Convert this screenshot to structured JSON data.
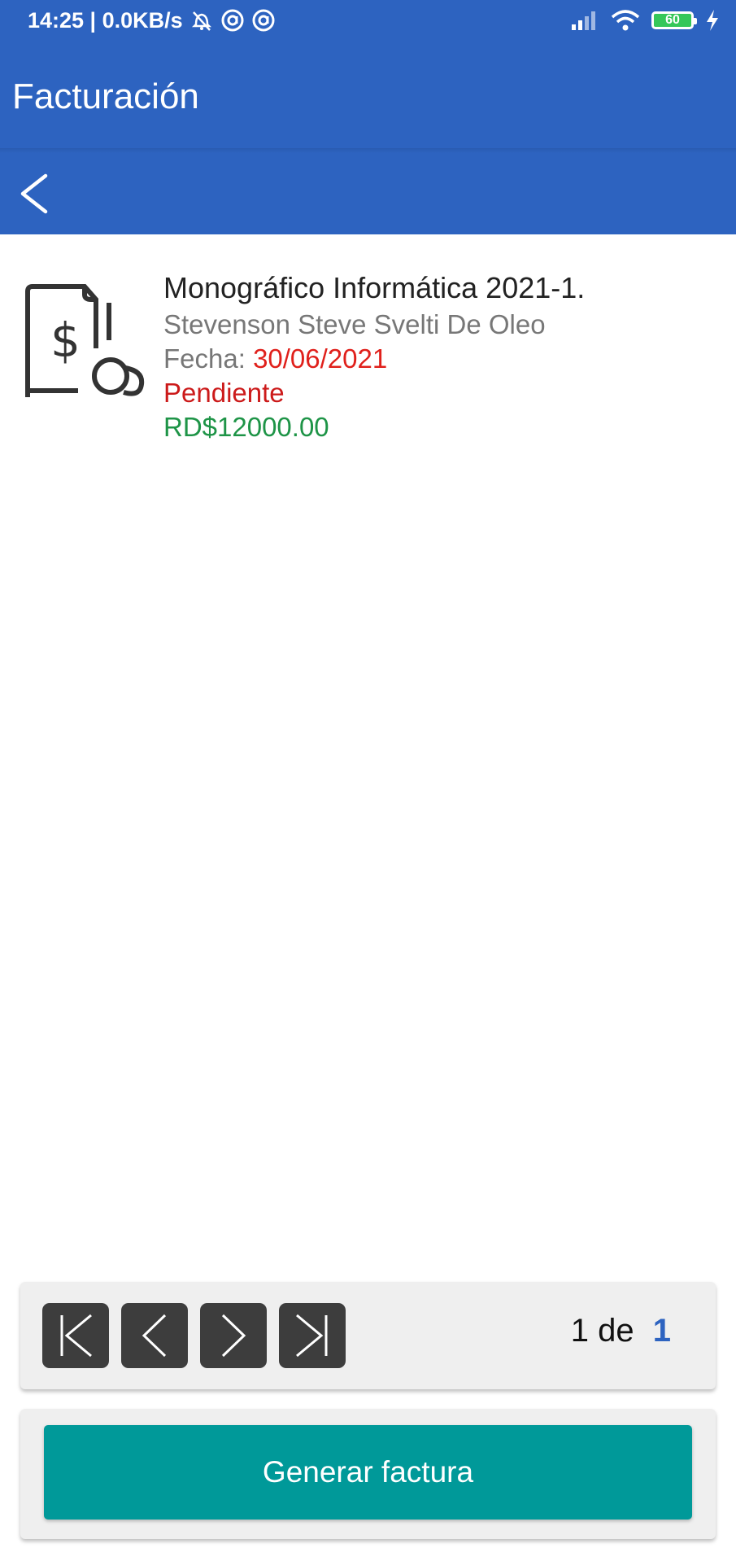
{
  "status_bar": {
    "time_speed": "14:25 | 0.0KB/s",
    "battery": "60",
    "icons": [
      "alarm-off-icon",
      "at-icon",
      "at-icon",
      "signal-icon",
      "wifi-icon",
      "battery-icon",
      "charging-icon"
    ]
  },
  "app_bar": {
    "title": "Facturación"
  },
  "nav": {
    "back_icon": "back-arrow-icon"
  },
  "invoice": {
    "icon": "invoice-dollar-coin-icon",
    "title": "Monográfico Informática 2021-1.",
    "student": "Stevenson Steve Svelti De Oleo",
    "date_label": "Fecha:",
    "date_value": "30/06/2021",
    "status": "Pendiente",
    "amount": "RD$12000.00",
    "colors": {
      "date": "#e0201b",
      "status": "#cc1a1a",
      "amount": "#1e9447"
    }
  },
  "pagination": {
    "current": "1",
    "separator": "de",
    "total": "1",
    "buttons": [
      "first-page-icon",
      "prev-page-icon",
      "next-page-icon",
      "last-page-icon"
    ]
  },
  "generate": {
    "label": "Generar factura",
    "color": "#009999"
  },
  "theme": {
    "primary": "#2d63c0"
  }
}
